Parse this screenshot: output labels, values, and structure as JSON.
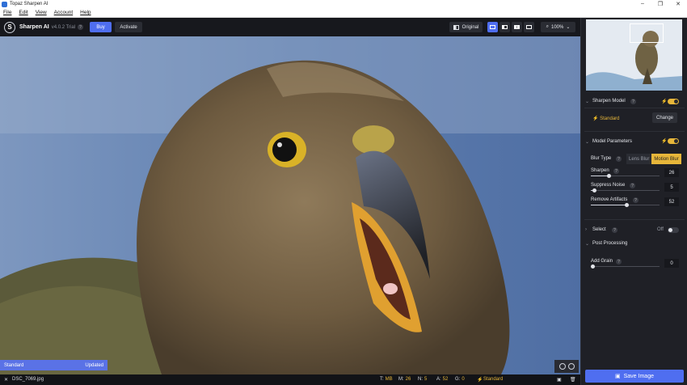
{
  "window": {
    "title": "Topaz Sharpen AI"
  },
  "menu": [
    "File",
    "Edit",
    "View",
    "Account",
    "Help"
  ],
  "toolbar": {
    "app_name": "Sharpen AI",
    "version": "v4.0.2 Trial",
    "buy_label": "Buy",
    "activate_label": "Activate",
    "original_label": "Original",
    "zoom_level": "100%"
  },
  "viewer": {
    "status_left": "Standard",
    "status_right": "Updated"
  },
  "bottom_bar": {
    "filename": "DSC_7069.jpg",
    "stats": [
      {
        "key": "T:",
        "value": "MB"
      },
      {
        "key": "M:",
        "value": "26"
      },
      {
        "key": "N:",
        "value": "5"
      },
      {
        "key": "A:",
        "value": "52"
      },
      {
        "key": "G:",
        "value": "0"
      }
    ],
    "model": "Standard"
  },
  "panel": {
    "sharpen_model": {
      "title": "Sharpen Model",
      "current": "Standard",
      "change_label": "Change",
      "enabled": true
    },
    "model_parameters": {
      "title": "Model Parameters",
      "enabled": true,
      "blur_type_label": "Blur Type",
      "blur_options": [
        "Lens Blur",
        "Motion Blur"
      ],
      "selected_blur": "Motion Blur",
      "params": [
        {
          "label": "Sharpen",
          "value": "26",
          "fraction": 0.26
        },
        {
          "label": "Suppress Noise",
          "value": "5",
          "fraction": 0.05
        },
        {
          "label": "Remove Artifacts",
          "value": "52",
          "fraction": 0.52
        }
      ]
    },
    "select": {
      "title": "Select",
      "state": "Off"
    },
    "post_processing": {
      "title": "Post Processing",
      "params": [
        {
          "label": "Add Grain",
          "value": "0",
          "fraction": 0
        }
      ]
    },
    "save_label": "Save Image"
  },
  "colors": {
    "accent_blue": "#4f6ef0",
    "accent_gold": "#e7b63a",
    "panel_bg": "#1f2026"
  }
}
